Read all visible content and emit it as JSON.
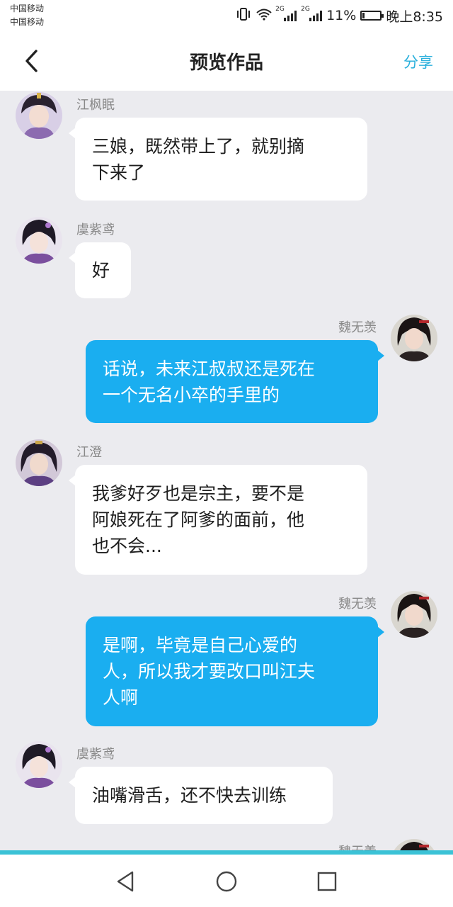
{
  "status_bar": {
    "carrier_1": "中国移动",
    "carrier_2": "中国移动",
    "network_1": "2G",
    "network_2": "2G",
    "battery": "11%",
    "time": "晚上8:35",
    "battery_level": 0.11
  },
  "header": {
    "back_icon": "chevron-left-icon",
    "title": "预览作品",
    "share_label": "分享"
  },
  "colors": {
    "accent": "#2bb0dc",
    "bubble_right": "#1aaef0",
    "bubble_left": "#ffffff",
    "chat_background": "#ebebef",
    "divider": "#3bc2d6"
  },
  "messages": [
    {
      "side": "left",
      "name": "江枫眠",
      "lines": [
        "三娘，既然带上了，就别摘",
        "下来了"
      ]
    },
    {
      "side": "left",
      "name": "虞紫鸢",
      "lines": [
        "好"
      ]
    },
    {
      "side": "right",
      "name": "魏无羡",
      "lines": [
        "话说，未来江叔叔还是死在",
        "一个无名小卒的手里的"
      ]
    },
    {
      "side": "left",
      "name": "江澄",
      "lines": [
        "我爹好歹也是宗主，要不是",
        "阿娘死在了阿爹的面前，他",
        "也不会..."
      ]
    },
    {
      "side": "right",
      "name": "魏无羡",
      "lines": [
        "是啊，毕竟是自己心爱的",
        "人，所以我才要改口叫江夫",
        "人啊"
      ]
    },
    {
      "side": "left",
      "name": "虞紫鸢",
      "lines": [
        "油嘴滑舌，还不快去训练"
      ]
    },
    {
      "side": "right",
      "name": "魏无羡",
      "lines": []
    }
  ],
  "system_nav": {
    "back_icon": "triangle-back-icon",
    "home_icon": "circle-home-icon",
    "recents_icon": "square-recents-icon"
  }
}
